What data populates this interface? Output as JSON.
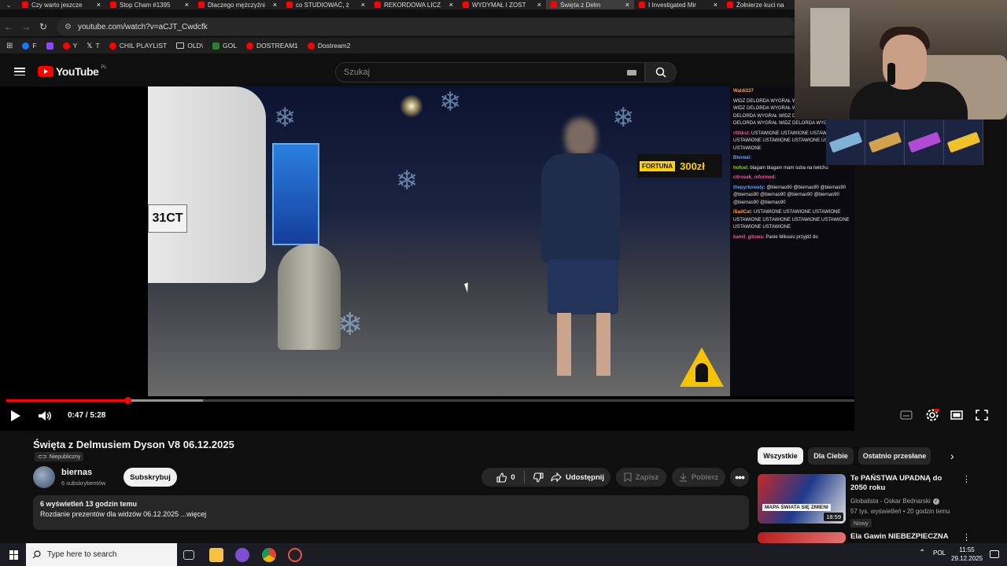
{
  "browser": {
    "tabs": [
      {
        "title": "Czy warto jeszcze"
      },
      {
        "title": "Stop Cham #1395"
      },
      {
        "title": "Dlaczego mężczyźni"
      },
      {
        "title": "co STUDIOWAĆ, ż"
      },
      {
        "title": "REKORDOWA LICZ"
      },
      {
        "title": "WYDYMAŁ I ZOST"
      },
      {
        "title": "Święta z Delm"
      },
      {
        "title": "I Investigated Mir"
      },
      {
        "title": "Żołnierze kuci na"
      }
    ],
    "active_tab_index": 6,
    "url": "youtube.com/watch?v=aCJT_Cwdcfk",
    "bookmarks": [
      {
        "label": "F",
        "icon": "facebook-icon"
      },
      {
        "label": "",
        "icon": "twitch-icon"
      },
      {
        "label": "Y",
        "icon": "youtube-icon"
      },
      {
        "label": "T",
        "icon": "x-icon"
      },
      {
        "label": "CHIL PLAYLIST",
        "icon": "youtube-icon"
      },
      {
        "label": "OLD\\",
        "icon": "folder-icon"
      },
      {
        "label": "GOL",
        "icon": "gol-icon"
      },
      {
        "label": "DOSTREAM1",
        "icon": "youtube-icon"
      },
      {
        "label": "Dostream2",
        "icon": "youtube-icon"
      }
    ]
  },
  "youtube": {
    "logo_text": "YouTube",
    "logo_region": "PL",
    "search_placeholder": "Szukaj"
  },
  "video": {
    "plate_text": "31CT",
    "ad_brand": "FORTUNA",
    "ad_amount": "300zł",
    "time_current": "0:47",
    "time_total": "5:28",
    "time_display": "0:47 / 5:28",
    "progress_fraction": 0.143,
    "chat": [
      {
        "user": "Waldi237",
        "text": "",
        "color": "u4"
      },
      {
        "user": "",
        "text": "WIDZ DELORDA WYGRAŁ  WIDZ DELORDA WYGRAŁ  WIDZ DELORDA WYGRAŁ  WIDZ DEL WYGRAŁ  WIDZ DELORDA WYGRAŁ  WIDZ DEL WYGRAŁ  WIDZ DELORDA WYGRAŁ  WIDZ DELORDA WYGRAŁ",
        "color": ""
      },
      {
        "user": "r00ikst:",
        "text": "USTAWIONE USTAWIONE USTAWIONE USTAWIONE USTAWIONE USTAWIONE USTAWIONE USTAWIONE",
        "color": "u"
      },
      {
        "user": "Bkowal:",
        "text": "",
        "color": "u2"
      },
      {
        "user": "hofcel:",
        "text": "blagam blagam mam suba na twitchu",
        "color": "u3"
      },
      {
        "user": "citrosek_reformed:",
        "text": "",
        "color": "u"
      },
      {
        "user": "thepyrkowaty:",
        "text": "@biernas90 @biernas90 @biernas90 @biernas90 @biernas90 @biernas90 @biernas90 @biernas90 @biernas90",
        "color": "u2"
      },
      {
        "user": "iSadCat:",
        "text": "USTAWIONE USTAWIONE USTAWIONE USTAWIONE USTAWIONE USTAWIONE USTAWIONE USTAWIONE USTAWIONE",
        "color": "u4"
      },
      {
        "user": "kamil_gituwa:",
        "text": "Panie Mikusiu przyjdź do",
        "color": "u"
      }
    ],
    "skins": [
      "",
      "",
      "",
      ""
    ]
  },
  "meta": {
    "title": "Święta z Delmusiem Dyson V8 06.12.2025",
    "visibility": "Niepubliczny",
    "channel": "biernas",
    "subscribers": "6 subskrybentów",
    "subscribe_label": "Subskrybuj",
    "likes": "0",
    "share_label": "Udostępnij",
    "save_label": "Zapisz",
    "download_label": "Pobierz",
    "views_time": "6 wyświetleń  13 godzin temu",
    "description": "Rozdanie prezentów dla widzów 06.12.2025 ...więcej"
  },
  "sidebar": {
    "chips": [
      "Wszystkie",
      "Dla Ciebie",
      "Ostatnio przesłane"
    ],
    "active_chip": 0,
    "recommendations": [
      {
        "title": "Te PAŃSTWA UPADNĄ do 2050 roku",
        "channel": "Globalista - Oskar Bednarski",
        "meta": "57 tys. wyświetleń • 20 godzin temu",
        "badge": "Nowy",
        "duration": "18:59",
        "thumb_text": "MAPA ŚWIATA SIĘ ZMIENI"
      },
      {
        "title": "Ela Gawin NIEBEZPIECZNA",
        "channel": "",
        "meta": "",
        "badge": "",
        "duration": "",
        "thumb_text": ""
      }
    ]
  },
  "taskbar": {
    "search_placeholder": "Type here to search",
    "language": "POL",
    "time": "11:55",
    "date": "29.12.2025"
  }
}
